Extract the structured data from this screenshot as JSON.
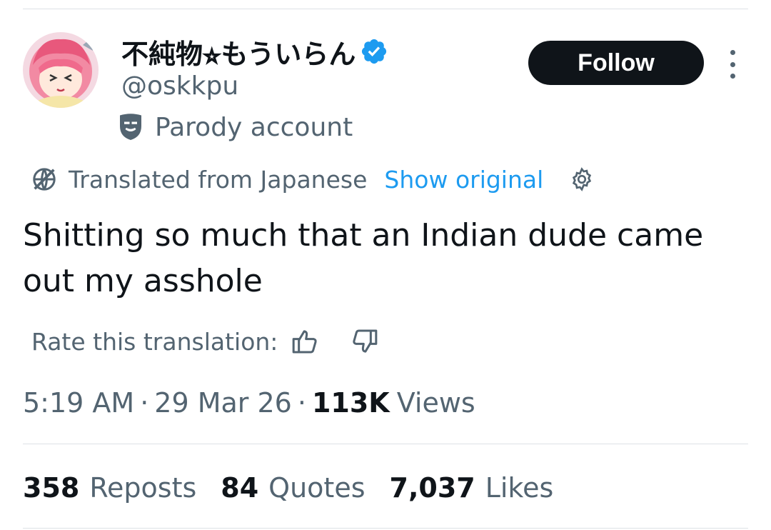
{
  "author": {
    "display_name": "不純物⭐︎もういらん",
    "handle": "@oskkpu",
    "badge_label": "Parody account",
    "verified_color": "#1d9bf0"
  },
  "follow_button": {
    "label": "Follow"
  },
  "translation": {
    "notice": "Translated from Japanese",
    "show_original": "Show original",
    "rate_label": "Rate this translation:"
  },
  "tweet": {
    "text": "Shitting so much that an Indian dude came out my asshole",
    "time": "5:19 AM",
    "date": "29 Mar 26",
    "separator": "·",
    "views_count": "113K",
    "views_label": "Views"
  },
  "stats": [
    {
      "count": "358",
      "label": "Reposts"
    },
    {
      "count": "84",
      "label": "Quotes"
    },
    {
      "count": "7,037",
      "label": "Likes"
    }
  ],
  "icons": {
    "verified": "verified-badge-icon",
    "parody": "theater-mask-icon",
    "translate": "globe-slash-icon",
    "settings": "gear-icon",
    "thumbs_up": "thumbs-up-icon",
    "thumbs_down": "thumbs-down-icon",
    "more": "more-vertical-icon"
  },
  "colors": {
    "accent": "#1d9bf0",
    "text_primary": "#0f1419",
    "text_secondary": "#536471",
    "button_bg": "#0f1419"
  }
}
